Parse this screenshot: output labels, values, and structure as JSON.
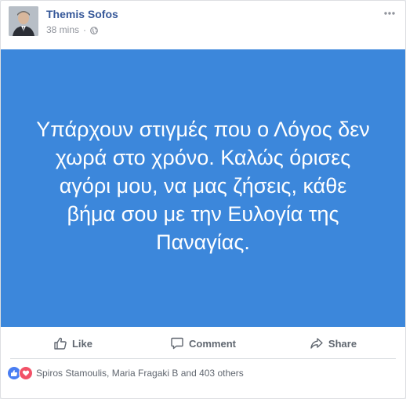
{
  "post": {
    "author": "Themis Sofos",
    "time": "38 mins",
    "separator": "·",
    "banner_text": "Υπάρχουν στιγμές που ο Λόγος δεν χωρά στο χρόνο. Καλώς όρισες αγόρι μου, να μας ζήσεις, κάθε βήμα σου με την Ευλογία της Παναγίας.",
    "banner_color": "#3c87db",
    "link_color": "#365899"
  },
  "actions": {
    "like": "Like",
    "comment": "Comment",
    "share": "Share"
  },
  "reactions": {
    "icons": [
      "like-icon",
      "love-icon"
    ],
    "text": "Spiros Stamoulis, Maria Fragaki B and 403 others"
  }
}
